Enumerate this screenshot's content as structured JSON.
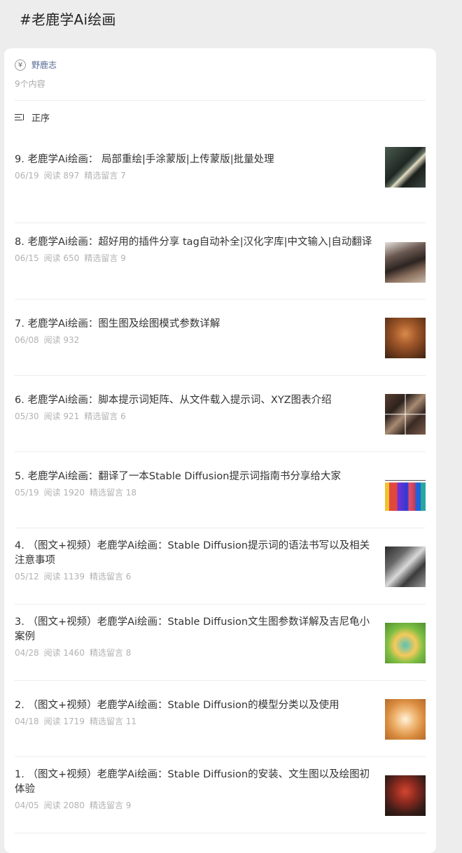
{
  "page": {
    "title": "#老鹿学Ai绘画"
  },
  "author": {
    "avatar_glyph": "¥",
    "name": "野鹿志"
  },
  "count_text": "9个内容",
  "sort": {
    "label": "正序",
    "icon": "sort-order-icon"
  },
  "articles": [
    {
      "title": "9. 老鹿学Ai绘画： 局部重绘|手涂蒙版|上传蒙版|批量处理",
      "date": "06/19",
      "reads": "阅读 897",
      "comments": "精选留言 7",
      "thumb": "image"
    },
    {
      "title": "8. 老鹿学Ai绘画：超好用的插件分享 tag自动补全|汉化字库|中文输入|自动翻译",
      "date": "06/15",
      "reads": "阅读 650",
      "comments": "精选留言 9",
      "thumb": "image"
    },
    {
      "title": "7. 老鹿学Ai绘画：图生图及绘图模式参数详解",
      "date": "06/08",
      "reads": "阅读 932",
      "comments": "",
      "thumb": "image"
    },
    {
      "title": "6. 老鹿学Ai绘画：脚本提示词矩阵、从文件载入提示词、XYZ图表介绍",
      "date": "05/30",
      "reads": "阅读 921",
      "comments": "精选留言 6",
      "thumb": "image"
    },
    {
      "title": "5. 老鹿学Ai绘画：翻译了一本Stable Diffusion提示词指南书分享给大家",
      "date": "05/19",
      "reads": "阅读 1920",
      "comments": "精选留言 18",
      "thumb": "image"
    },
    {
      "title": "4. （图文+视频）老鹿学Ai绘画：Stable Diffusion提示词的语法书写以及相关注意事项",
      "date": "05/12",
      "reads": "阅读 1139",
      "comments": "精选留言 6",
      "thumb": "image"
    },
    {
      "title": "3. （图文+视频）老鹿学Ai绘画：Stable Diffusion文生图参数详解及吉尼龟小案例",
      "date": "04/28",
      "reads": "阅读 1460",
      "comments": "精选留言 8",
      "thumb": "image"
    },
    {
      "title": "2. （图文+视频）老鹿学Ai绘画：Stable Diffusion的模型分类以及使用",
      "date": "04/18",
      "reads": "阅读 1719",
      "comments": "精选留言 11",
      "thumb": "image"
    },
    {
      "title": "1. （图文+视频）老鹿学Ai绘画：Stable Diffusion的安装、文生图以及绘图初体验",
      "date": "04/05",
      "reads": "阅读 2080",
      "comments": "精选留言 9",
      "thumb": "image"
    }
  ],
  "colors": {
    "background": "#ededed",
    "card": "#ffffff",
    "author_link": "#576b95",
    "meta": "#b2b2b2"
  }
}
